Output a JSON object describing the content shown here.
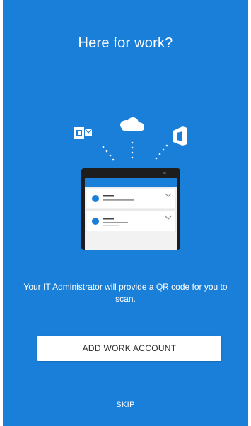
{
  "header": {
    "title": "Here for work?"
  },
  "illustration": {
    "icons": [
      "outlook-icon",
      "onedrive-cloud-icon",
      "office-icon"
    ],
    "device": "tablet-with-account-list"
  },
  "body": {
    "message": "Your IT Administrator will provide a QR code for you to scan."
  },
  "actions": {
    "add_work_account_label": "ADD WORK ACCOUNT",
    "skip_label": "SKIP"
  },
  "colors": {
    "background": "#1a7fd9",
    "button": "#ffffff",
    "text": "#ffffff"
  }
}
